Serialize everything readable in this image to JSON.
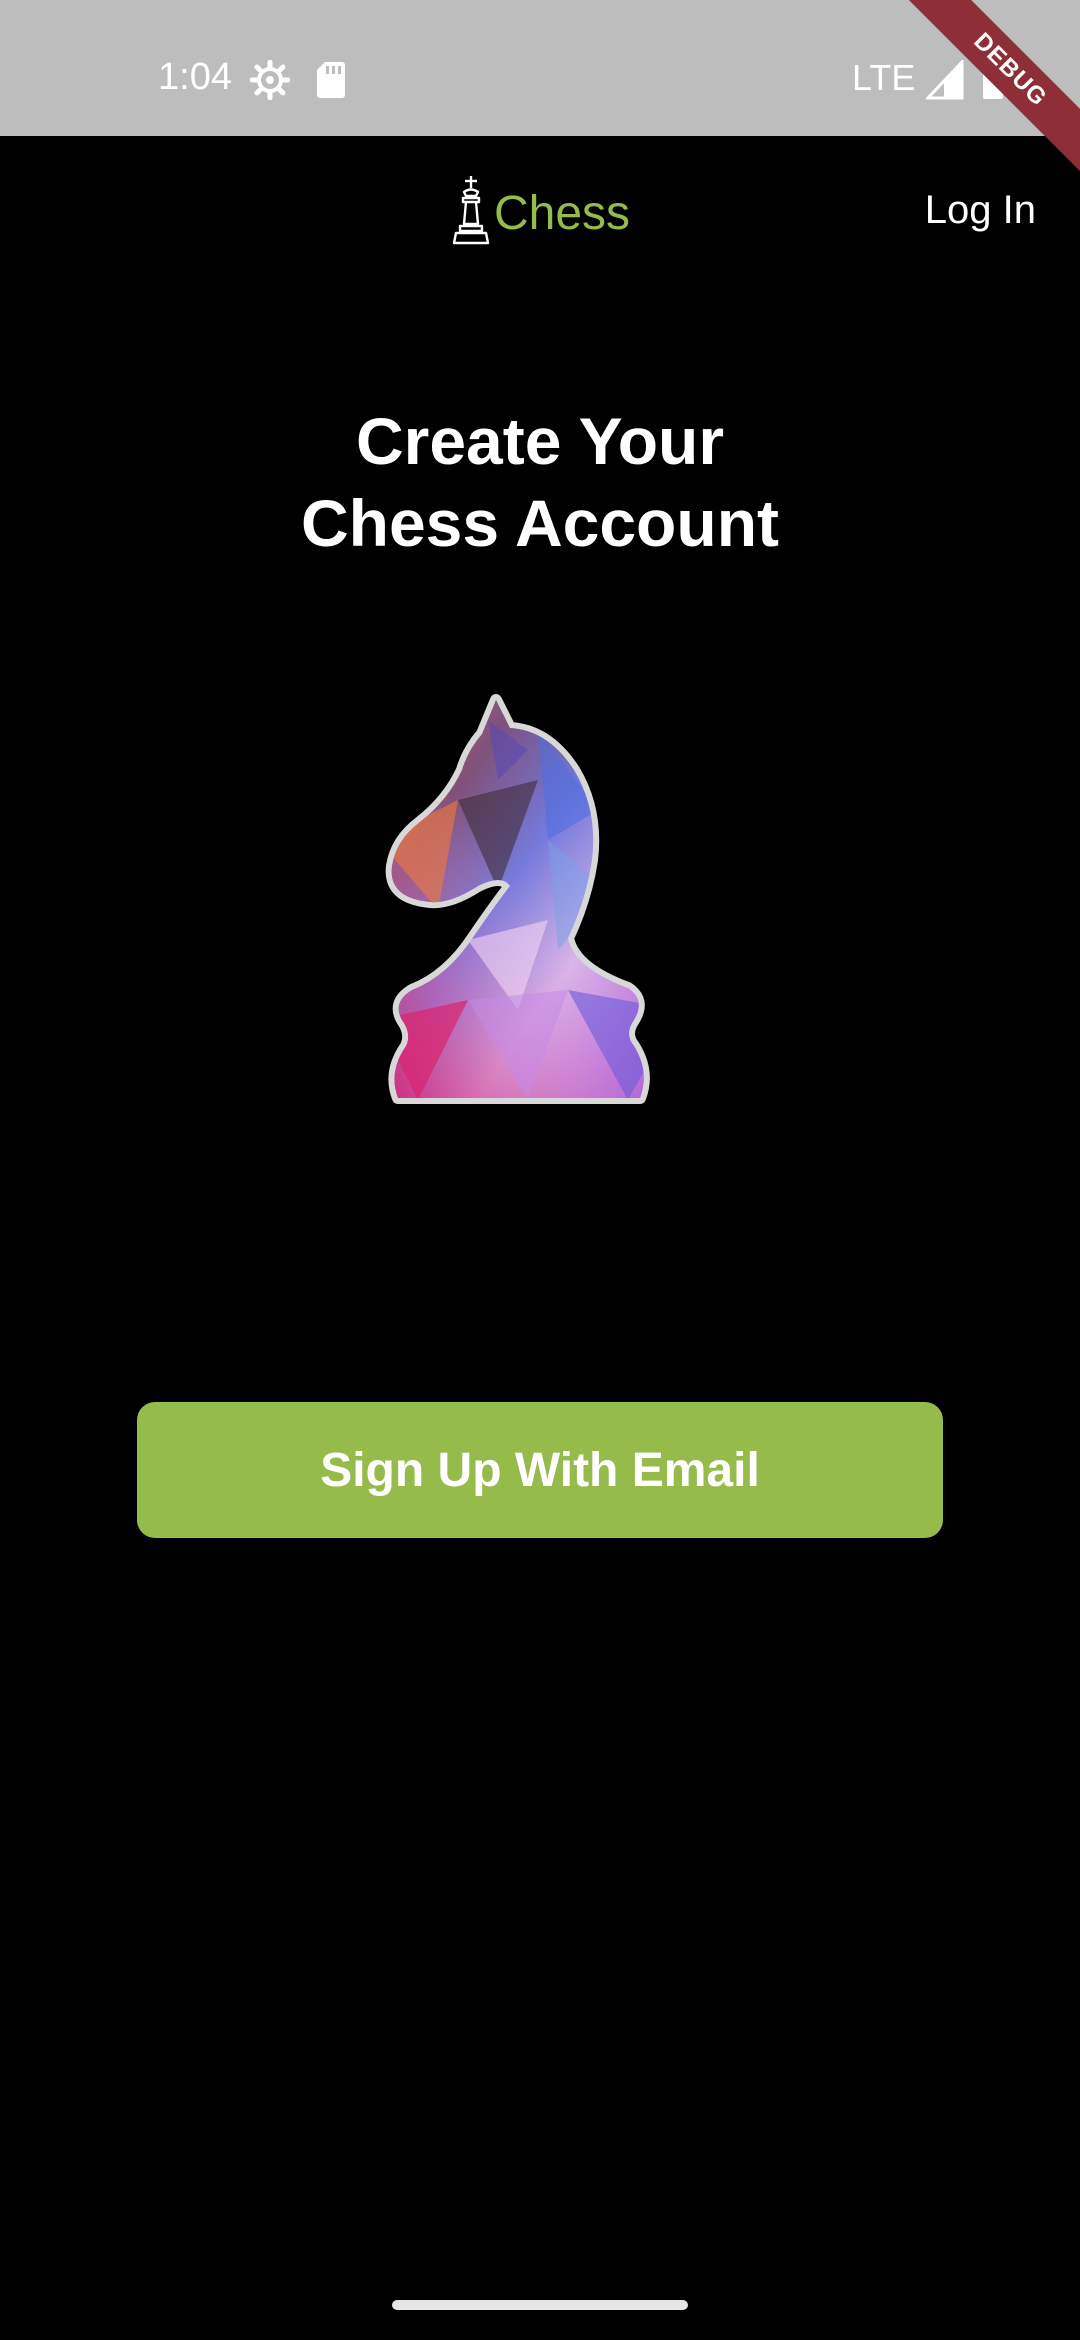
{
  "status_bar": {
    "time": "1:04",
    "network": "LTE",
    "icons": [
      "settings-gear-icon",
      "sd-card-icon",
      "signal-icon",
      "battery-icon"
    ],
    "debug_label": "DEBUG"
  },
  "app_bar": {
    "brand_name": "Chess",
    "brand_icon": "chess-king-icon",
    "login_label": "Log In"
  },
  "main": {
    "title_line1": "Create Your",
    "title_line2": "Chess Account",
    "illustration": "chess-knight-illustration",
    "signup_label": "Sign Up With Email"
  },
  "colors": {
    "accent": "#95bb4b",
    "background": "#000000",
    "status_bar": "#bdbdbd",
    "debug_ribbon": "#8e2f38"
  }
}
